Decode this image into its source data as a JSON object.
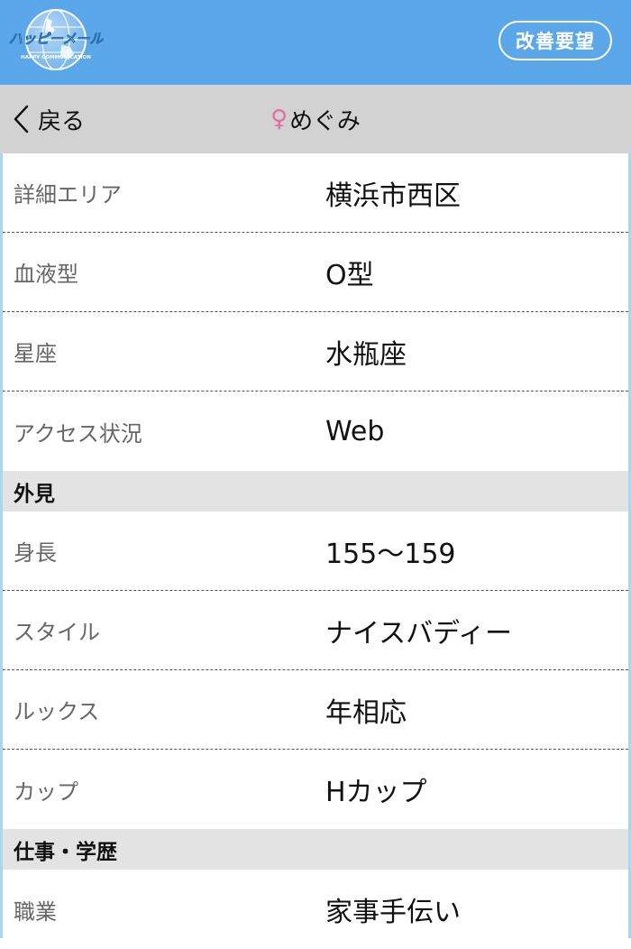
{
  "header": {
    "logo_text": "ハッピーメール",
    "logo_subtext": "HAPPY COMMUNICATION",
    "improve_button": "改善要望",
    "colors": {
      "header_bg": "#5aa7ea",
      "nav_bg": "#d2d2d2",
      "section_bg": "#e3e3e3",
      "female_symbol": "#e86aa0"
    }
  },
  "nav": {
    "back_label": "戻る",
    "gender_symbol": "♀",
    "title": "めぐみ"
  },
  "profile": {
    "basic_rows": [
      {
        "label": "詳細エリア",
        "value": "横浜市西区"
      },
      {
        "label": "血液型",
        "value": "O型"
      },
      {
        "label": "星座",
        "value": "水瓶座"
      },
      {
        "label": "アクセス状況",
        "value": "Web"
      }
    ],
    "appearance_section": "外見",
    "appearance_rows": [
      {
        "label": "身長",
        "value": "155〜159"
      },
      {
        "label": "スタイル",
        "value": "ナイスバディー"
      },
      {
        "label": "ルックス",
        "value": "年相応"
      },
      {
        "label": "カップ",
        "value": "Hカップ"
      }
    ],
    "work_section": "仕事・学歴",
    "work_rows": [
      {
        "label": "職業",
        "value": "家事手伝い"
      }
    ]
  }
}
